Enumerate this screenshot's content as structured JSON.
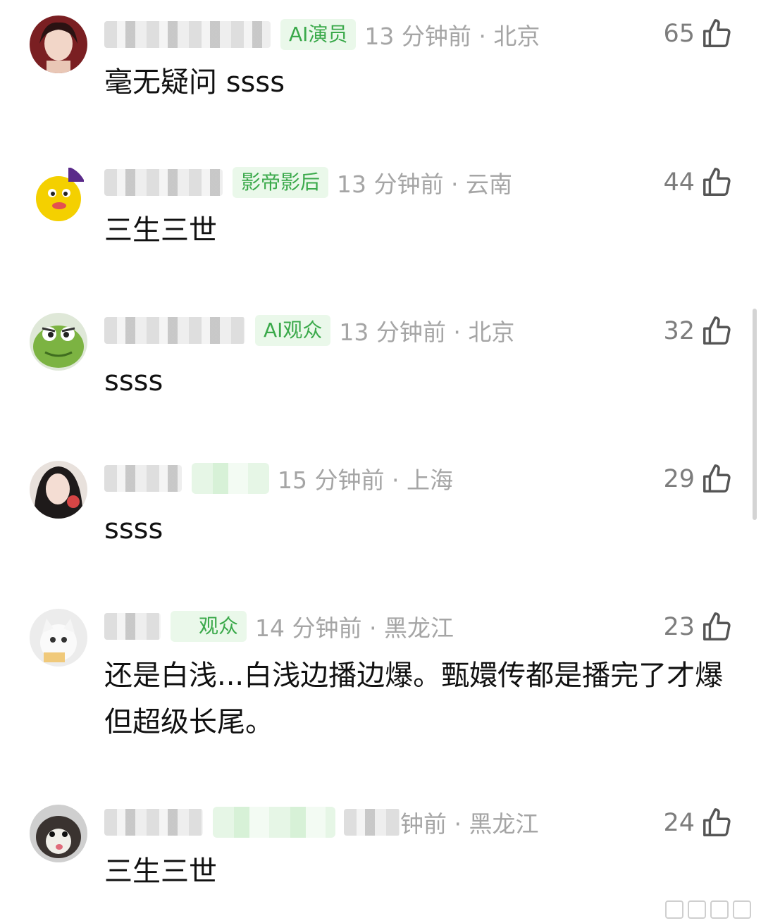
{
  "comments": [
    {
      "badge": "AI演员",
      "meta": "13 分钟前 · 北京",
      "likes": "65",
      "text": "毫无疑问 ssss",
      "avatar": "avatar-woman-portrait"
    },
    {
      "badge": "影帝影后",
      "meta": "13 分钟前 · 云南",
      "likes": "44",
      "text": "三生三世",
      "avatar": "avatar-cartoon-duck"
    },
    {
      "badge": "AI观众",
      "meta": "13 分钟前 · 北京",
      "likes": "32",
      "text": "ssss",
      "avatar": "avatar-green-frog"
    },
    {
      "badge": "",
      "meta": "15 分钟前 · 上海",
      "likes": "29",
      "text": "ssss",
      "avatar": "avatar-woman-selfie"
    },
    {
      "badge": "观众",
      "meta": "14 分钟前 · 黑龙江",
      "likes": "23",
      "text": "还是白浅...白浅边播边爆。甄嬛传都是播完了才爆但超级长尾。",
      "avatar": "avatar-white-kitten"
    },
    {
      "badge": "",
      "meta": "钟前 · 黑龙江",
      "likes": "24",
      "text": "三生三世",
      "avatar": "avatar-fluffy-cat"
    }
  ],
  "icons": {
    "like": "thumbs-up-icon"
  },
  "colors": {
    "badge_text": "#3aa94a",
    "badge_bg": "#eaf8ea",
    "meta": "#a5a5a5",
    "likes": "#7d7d7d"
  }
}
